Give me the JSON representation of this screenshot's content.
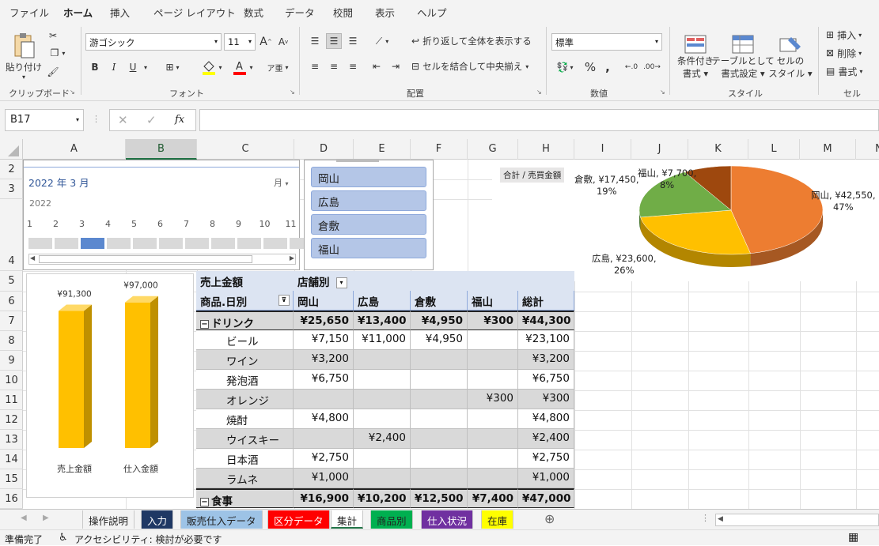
{
  "menu": {
    "tabs": [
      "ファイル",
      "ホーム",
      "挿入",
      "ページ レイアウト",
      "数式",
      "データ",
      "校閲",
      "表示",
      "ヘルプ"
    ],
    "active_index": 1
  },
  "ribbon": {
    "clipboard": {
      "label": "クリップボード",
      "paste": "貼り付け"
    },
    "font": {
      "label": "フォント",
      "font_name": "游ゴシック",
      "font_size": "11"
    },
    "alignment": {
      "label": "配置",
      "wrap_text": "折り返して全体を表示する",
      "merge_center": "セルを結合して中央揃え"
    },
    "number": {
      "label": "数値",
      "format": "標準"
    },
    "styles": {
      "label": "スタイル",
      "conditional_1": "条件付き",
      "conditional_2": "書式",
      "table_1": "テーブルとして",
      "table_2": "書式設定",
      "cell_1": "セルの",
      "cell_2": "スタイル"
    },
    "cells": {
      "label": "セル",
      "insert": "挿入",
      "delete": "削除",
      "format": "書式"
    }
  },
  "formula_bar": {
    "name_box": "B17",
    "fx": "fx",
    "formula": ""
  },
  "columns": [
    "A",
    "B",
    "C",
    "D",
    "E",
    "F",
    "G",
    "H",
    "I",
    "J",
    "K",
    "L",
    "M",
    "N"
  ],
  "selected_column": "B",
  "rows": [
    "2",
    "3",
    "4",
    "5",
    "6",
    "7",
    "8",
    "9",
    "10",
    "11",
    "12",
    "13",
    "14",
    "15",
    "16"
  ],
  "timeline": {
    "title": "2022 年 3 月",
    "level": "月",
    "year": "2022",
    "months": [
      "1",
      "2",
      "3",
      "4",
      "5",
      "6",
      "7",
      "8",
      "9",
      "10",
      "11"
    ],
    "selected_month": 3
  },
  "slicer": {
    "items": [
      "岡山",
      "広島",
      "倉敷",
      "福山"
    ]
  },
  "pivot": {
    "value_label": "売上金額",
    "col_field": "店舗別",
    "row_field": "商品.日別",
    "columns": [
      "岡山",
      "広島",
      "倉敷",
      "福山",
      "総計"
    ],
    "rows": [
      {
        "label": "ドリンク",
        "group": true,
        "values": [
          "¥25,650",
          "¥13,400",
          "¥4,950",
          "¥300",
          "¥44,300"
        ]
      },
      {
        "label": "ビール",
        "values": [
          "¥7,150",
          "¥11,000",
          "¥4,950",
          "",
          "¥23,100"
        ]
      },
      {
        "label": "ワイン",
        "values": [
          "¥3,200",
          "",
          "",
          "",
          "¥3,200"
        ]
      },
      {
        "label": "発泡酒",
        "values": [
          "¥6,750",
          "",
          "",
          "",
          "¥6,750"
        ]
      },
      {
        "label": "オレンジ",
        "values": [
          "",
          "",
          "",
          "¥300",
          "¥300"
        ]
      },
      {
        "label": "焼酎",
        "values": [
          "¥4,800",
          "",
          "",
          "",
          "¥4,800"
        ]
      },
      {
        "label": "ウイスキー",
        "values": [
          "",
          "¥2,400",
          "",
          "",
          "¥2,400"
        ]
      },
      {
        "label": "日本酒",
        "values": [
          "¥2,750",
          "",
          "",
          "",
          "¥2,750"
        ]
      },
      {
        "label": "ラムネ",
        "values": [
          "¥1,000",
          "",
          "",
          "",
          "¥1,000"
        ]
      },
      {
        "label": "食事",
        "group": true,
        "values": [
          "¥16,900",
          "¥10,200",
          "¥12,500",
          "¥7,400",
          "¥47,000"
        ]
      }
    ]
  },
  "chart_data": [
    {
      "type": "pie",
      "field_button": "合計 / 売買金額",
      "slices": [
        {
          "name": "岡山",
          "value": 42550,
          "value_label": "¥42,550",
          "percent": "47%",
          "color": "#ed7d31"
        },
        {
          "name": "広島",
          "value": 23600,
          "value_label": "¥23,600",
          "percent": "26%",
          "color": "#ffc000"
        },
        {
          "name": "倉敷",
          "value": 17450,
          "value_label": "¥17,450",
          "percent": "19%",
          "color": "#70ad47"
        },
        {
          "name": "福山",
          "value": 7700,
          "value_label": "¥7,700",
          "percent": "8%",
          "color": "#9e480e"
        }
      ]
    },
    {
      "type": "bar",
      "categories": [
        "売上金額",
        "仕入金額"
      ],
      "values": [
        91300,
        97000
      ],
      "value_labels": [
        "¥91,300",
        "¥97,000"
      ],
      "ylim": [
        0,
        100000
      ],
      "color": "#ffc000"
    }
  ],
  "sheets": [
    {
      "name": "操作説明",
      "bg": "#f3f3f3",
      "fg": "#222222"
    },
    {
      "name": "入力",
      "bg": "#1f3864",
      "fg": "#ffffff"
    },
    {
      "name": "販売仕入データ",
      "bg": "#9dc3e6",
      "fg": "#222222"
    },
    {
      "name": "区分データ",
      "bg": "#ff0000",
      "fg": "#ffffff"
    },
    {
      "name": "集計",
      "bg": "#ffffff",
      "fg": "#222222",
      "active": true
    },
    {
      "name": "商品別",
      "bg": "#00b050",
      "fg": "#222222"
    },
    {
      "name": "仕入状況",
      "bg": "#7030a0",
      "fg": "#ffffff"
    },
    {
      "name": "在庫",
      "bg": "#ffff00",
      "fg": "#222222"
    }
  ],
  "status": {
    "ready": "準備完了",
    "accessibility": "アクセシビリティ: 検討が必要です"
  }
}
